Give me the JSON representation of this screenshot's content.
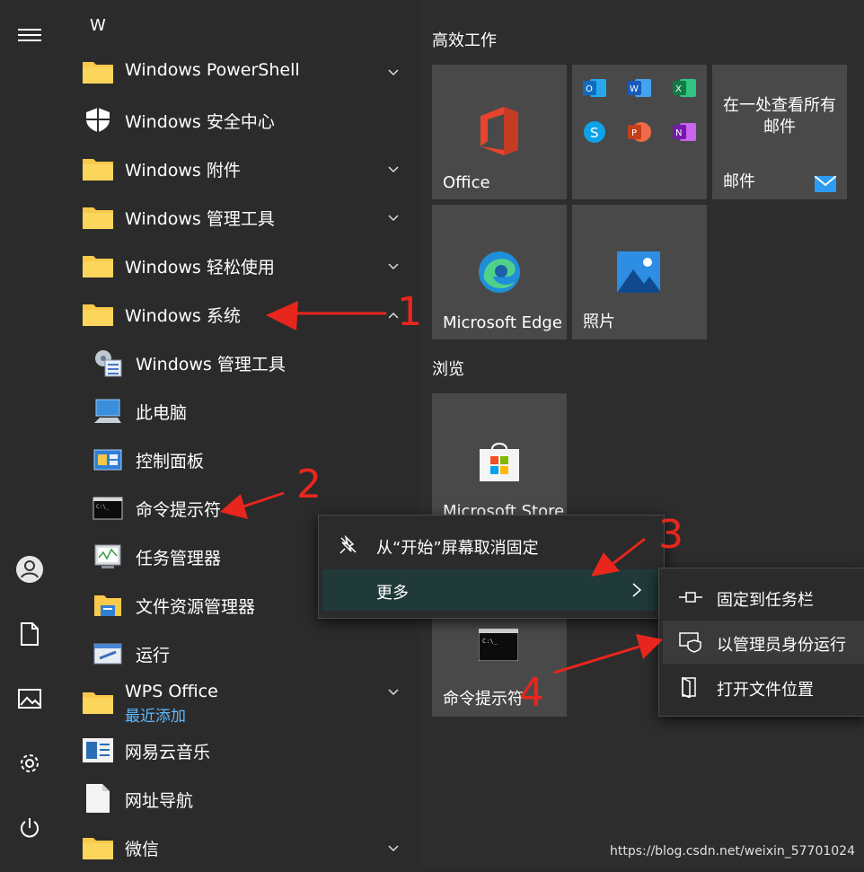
{
  "app_list": {
    "letter": "W",
    "items": [
      {
        "label": "Windows PowerShell",
        "icon": "folder-icon",
        "chevron": "down"
      },
      {
        "label": "Windows 安全中心",
        "icon": "shield-icon",
        "chevron": ""
      },
      {
        "label": "Windows 附件",
        "icon": "folder-icon",
        "chevron": "down"
      },
      {
        "label": "Windows 管理工具",
        "icon": "folder-icon",
        "chevron": "down"
      },
      {
        "label": "Windows 轻松使用",
        "icon": "folder-icon",
        "chevron": "down"
      },
      {
        "label": "Windows 系统",
        "icon": "folder-icon",
        "chevron": "up"
      }
    ],
    "sub_items": [
      {
        "label": "Windows 管理工具",
        "icon": "admin-tools-icon"
      },
      {
        "label": "此电脑",
        "icon": "this-pc-icon"
      },
      {
        "label": "控制面板",
        "icon": "control-panel-icon"
      },
      {
        "label": "命令提示符",
        "icon": "cmd-icon"
      },
      {
        "label": "任务管理器",
        "icon": "task-manager-icon"
      },
      {
        "label": "文件资源管理器",
        "icon": "file-explorer-icon"
      },
      {
        "label": "运行",
        "icon": "run-icon"
      }
    ],
    "wps": {
      "label": "WPS Office",
      "badge": "最近添加"
    },
    "tail_items": [
      {
        "label": "网易云音乐",
        "icon": "netease-music-icon"
      },
      {
        "label": "网址导航",
        "icon": "web-nav-icon"
      },
      {
        "label": "微信",
        "icon": "folder-icon"
      }
    ]
  },
  "rail": {
    "icons": [
      "hamburger-icon",
      "user-icon",
      "document-icon",
      "pictures-icon",
      "settings-icon",
      "power-icon"
    ]
  },
  "tiles": {
    "group1": "高效工作",
    "group2": "浏览",
    "office": "Office",
    "mail_text": "在一处查看所有邮件",
    "mail_label": "邮件",
    "edge": "Microsoft Edge",
    "photos": "照片",
    "store": "Microsoft Store",
    "cmd": "命令提示符"
  },
  "context_menu": {
    "unpin": "从“开始”屏幕取消固定",
    "more": "更多"
  },
  "submenu": {
    "pin_taskbar": "固定到任务栏",
    "run_admin": "以管理员身份运行",
    "open_location": "打开文件位置"
  },
  "annotations": [
    "1",
    "2",
    "3",
    "4"
  ],
  "watermark": "https://blog.csdn.net/weixin_57701024",
  "colors": {
    "accent": "#e8261d",
    "menu_bg": "#2b2b2b",
    "hover": "#1f3a38"
  }
}
